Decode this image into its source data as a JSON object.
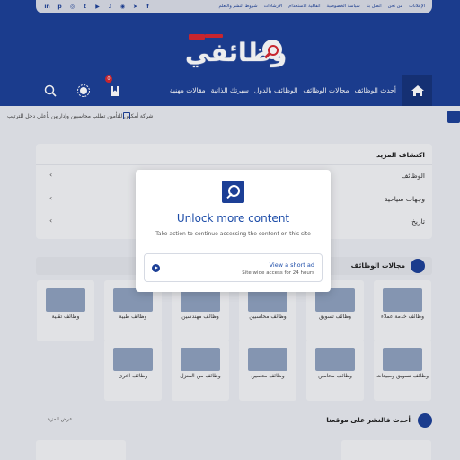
{
  "topbar": {
    "social_icons": [
      "in",
      "p",
      "◎",
      "t",
      "▶",
      "♪",
      "◉",
      "➤",
      "f"
    ],
    "links": [
      "الإعلانات",
      "من نحن",
      "اتصل بنا",
      "سياسة الخصوصية",
      "اتفاقية الاستخدام",
      "الإرشادات",
      "شروط النشر والتعلم"
    ]
  },
  "logo": {
    "text": "وظائفي"
  },
  "nav": {
    "items": [
      "أحدث الوظائف",
      "مجالات الوظائف",
      "الوظائف بالدول",
      "سيرتك الذاتية",
      "مقالات مهنية"
    ],
    "badge": "0"
  },
  "ticker": {
    "text": "شركة أمكس للتأمين تطلب محاسبين وإداريين بأعلى دخل للترتيب"
  },
  "explore": {
    "title": "اكتشاف المزيد",
    "rows": [
      "الوظائف",
      "وجهات سياحية",
      "تاريخ"
    ]
  },
  "section": {
    "title": "مجالات الوظائف"
  },
  "tiles_row1": [
    "وظائف خدمة عملاء",
    "وظائف تسويق",
    "وظائف محاسبين",
    "وظائف مهندسين",
    "وظائف طبية",
    "وظائف تقنية"
  ],
  "tiles_row2": [
    "وظائف تسويق ومبيعات",
    "وظائف محامين",
    "وظائف معلمين",
    "وظائف من المنزل",
    "وظائف اخرى"
  ],
  "jobs": {
    "title": "أحدث فالنشر على موقعنا",
    "more": "عرض المزيد"
  },
  "modal": {
    "title": "Unlock more content",
    "subtitle": "Take action to continue accessing the content on this site",
    "option_title": "View a short ad",
    "option_sub": "Site wide access for 24 hours"
  },
  "colors": {
    "brand": "#1c3f96",
    "accent": "#d6262f",
    "modal_title": "#1c4ca8"
  }
}
